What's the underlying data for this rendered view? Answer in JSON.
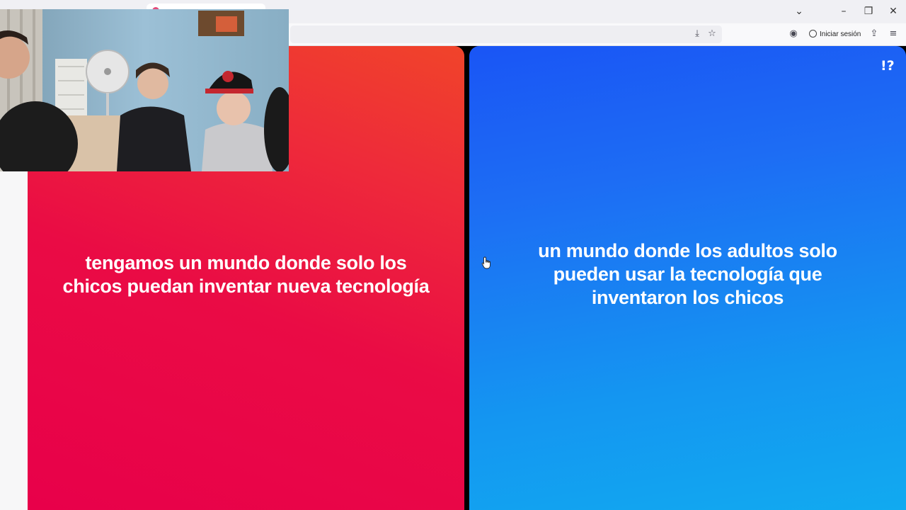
{
  "browser": {
    "signin_label": "Iniciar sesión",
    "window_controls": [
      "chevron-down-icon",
      "minimize-icon",
      "restore-icon",
      "close-icon"
    ],
    "toolbar_icons": [
      "download-icon",
      "star-icon",
      "screenshot-icon",
      "extensions-icon",
      "menu-icon"
    ]
  },
  "options": {
    "left": {
      "text": "tengamos un mundo donde solo los chicos puedan inventar nueva tecnología",
      "color": "#e8004a"
    },
    "right": {
      "text": "un mundo donde los adultos solo pueden usar la tecnología que inventaron los chicos",
      "color": "#1a7ff3"
    }
  },
  "site": {
    "logo": "!?"
  }
}
